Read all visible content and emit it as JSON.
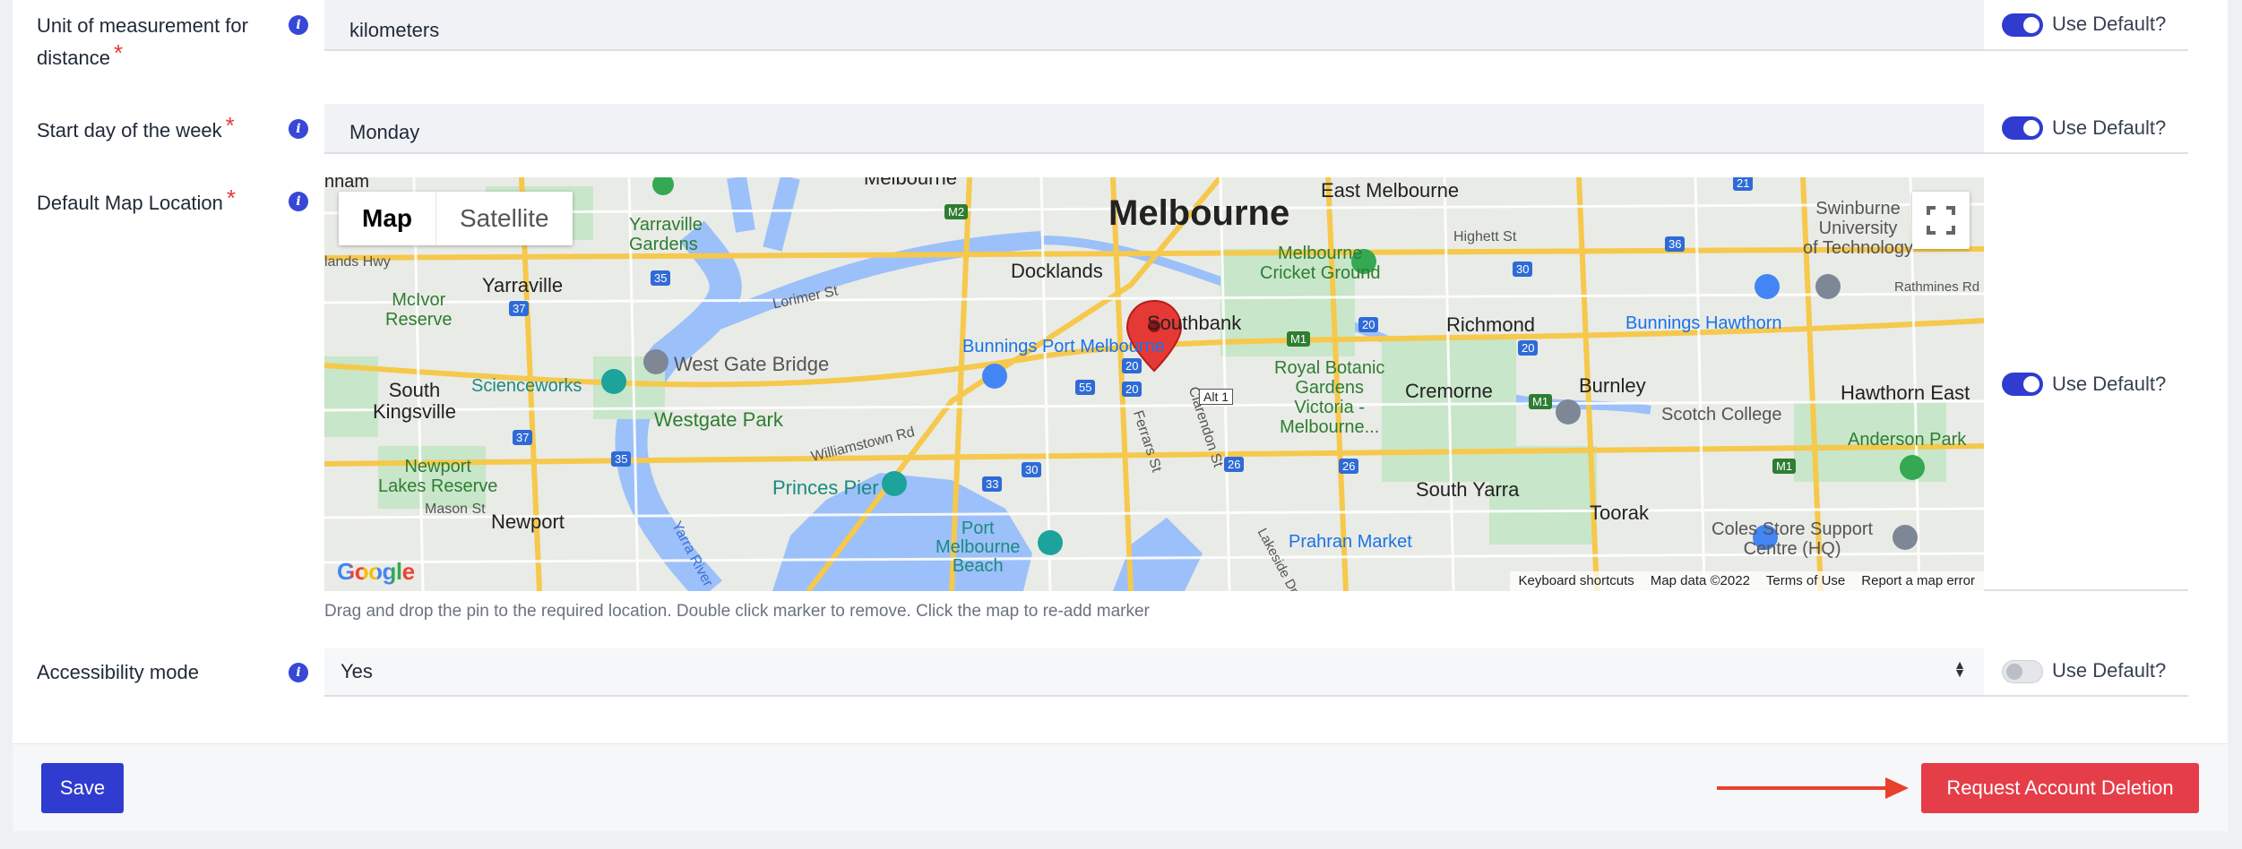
{
  "fields": [
    {
      "label_line1": "Unit of measurement for",
      "label_line2": "distance",
      "value": "kilometers",
      "use_default": "Use Default?",
      "default_on": true
    },
    {
      "label": "Start day of the week",
      "value": "Monday",
      "use_default": "Use Default?",
      "default_on": true
    },
    {
      "label": "Default Map Location",
      "use_default": "Use Default?",
      "default_on": true
    },
    {
      "label": "Accessibility mode",
      "value": "Yes",
      "use_default": "Use Default?",
      "default_on": false
    }
  ],
  "required_mark": "*",
  "info_icon": "i",
  "map": {
    "tabs": [
      "Map",
      "Satellite"
    ],
    "active_tab": "Map",
    "labels": {
      "melbourne": "Melbourne",
      "east_melbourne": "East Melbourne",
      "north_melbourne": "Melbourne",
      "docklands": "Docklands",
      "southbank": "Southbank",
      "richmond": "Richmond",
      "cremorne": "Cremorne",
      "burnley": "Burnley",
      "hawthorn_east": "Hawthorn East",
      "south_yarra": "South Yarra",
      "toorak": "Toorak",
      "yarraville": "Yarraville",
      "yarraville_gardens": "Yarraville\nGardens",
      "south_kingsville": "South\nKingsville",
      "newport": "Newport",
      "newport_lakes": "Newport\nLakes Reserve",
      "mcivor": "McIvor\nReserve",
      "scienceworks": "Scienceworks",
      "west_gate_bridge": "West Gate Bridge",
      "westgate_park": "Westgate Park",
      "princes_pier": "Princes Pier",
      "port_melbourne_beach": "Port\nMelbourne\nBeach",
      "bunnings_port_melbourne": "Bunnings Port Melbourne",
      "bunnings_hawthorn": "Bunnings Hawthorn",
      "mcg": "Melbourne\nCricket Ground",
      "royal_botanic": "Royal Botanic\nGardens\nVictoria -\nMelbourne...",
      "prahran_market": "Prahran Market",
      "scotch_college": "Scotch College",
      "swinburne": "Swinburne\nUniversity\nof Technology",
      "anderson_park": "Anderson Park",
      "coles_store": "Coles Store Support\nCentre (HQ)",
      "lorimer_st": "Lorimer St",
      "williamstown_rd": "Williamstown Rd",
      "ferrars_st": "Ferrars St",
      "clarendon_st": "Clarendon St",
      "yarra_river": "Yarra River",
      "lakeside_dr": "Lakeside Dr",
      "mason_st": "Mason St",
      "highett_st": "Highett St",
      "rathmines_rd": "Rathmines Rd",
      "lands_hwy": "lands Hwy",
      "nham": "nham",
      "alt1": "Alt 1"
    },
    "route_shields": [
      "35",
      "37",
      "37",
      "35",
      "M2",
      "M1",
      "M1",
      "M1",
      "20",
      "20",
      "55",
      "30",
      "33",
      "26",
      "26",
      "36",
      "21",
      "30",
      "20",
      "20"
    ],
    "google_logo": "Google",
    "attribution": [
      "Keyboard shortcuts",
      "Map data ©2022",
      "Terms of Use",
      "Report a map error"
    ]
  },
  "hint": "Drag and drop the pin to the required location. Double click marker to remove. Click the map to re-add marker",
  "buttons": {
    "save": "Save",
    "request_deletion": "Request Account Deletion"
  },
  "colors": {
    "primary": "#2f3ccf",
    "danger": "#e53e48",
    "arrow": "#e8412c"
  }
}
